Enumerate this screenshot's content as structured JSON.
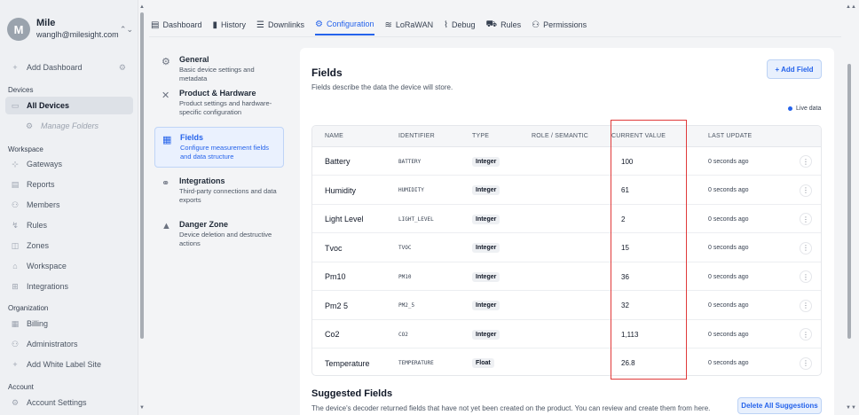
{
  "account": {
    "initial": "M",
    "name": "Mile",
    "email": "wanglh@milesight.com"
  },
  "sidebar": {
    "add_dashboard": "Add Dashboard",
    "devices_section": "Devices",
    "all_devices": "All Devices",
    "manage_folders": "Manage Folders",
    "workspace_section": "Workspace",
    "gateways": "Gateways",
    "reports": "Reports",
    "members": "Members",
    "rules": "Rules",
    "zones": "Zones",
    "workspace": "Workspace",
    "integrations": "Integrations",
    "organization_section": "Organization",
    "billing": "Billing",
    "administrators": "Administrators",
    "add_white_label": "Add White Label Site",
    "account_section": "Account",
    "account_settings": "Account Settings"
  },
  "tabs": [
    "Dashboard",
    "History",
    "Downlinks",
    "Configuration",
    "LoRaWAN",
    "Debug",
    "Rules",
    "Permissions"
  ],
  "settings_nav": [
    {
      "title": "General",
      "desc": "Basic device settings and metadata"
    },
    {
      "title": "Product & Hardware",
      "desc": "Product settings and hardware-specific configuration"
    },
    {
      "title": "Fields",
      "desc": "Configure measurement fields and data structure"
    },
    {
      "title": "Integrations",
      "desc": "Third-party connections and data exports"
    },
    {
      "title": "Danger Zone",
      "desc": "Device deletion and destructive actions"
    }
  ],
  "fields": {
    "title": "Fields",
    "description": "Fields describe the data the device will store.",
    "add_button": "+ Add Field",
    "live_data": "Live data",
    "columns": [
      "NAME",
      "IDENTIFIER",
      "TYPE",
      "ROLE / SEMANTIC",
      "CURRENT VALUE",
      "LAST UPDATE"
    ],
    "rows": [
      {
        "name": "Battery",
        "identifier": "BATTERY",
        "type": "Integer",
        "value": "100",
        "updated": "0 seconds ago"
      },
      {
        "name": "Humidity",
        "identifier": "HUMIDITY",
        "type": "Integer",
        "value": "61",
        "updated": "0 seconds ago"
      },
      {
        "name": "Light Level",
        "identifier": "LIGHT_LEVEL",
        "type": "Integer",
        "value": "2",
        "updated": "0 seconds ago"
      },
      {
        "name": "Tvoc",
        "identifier": "TVOC",
        "type": "Integer",
        "value": "15",
        "updated": "0 seconds ago"
      },
      {
        "name": "Pm10",
        "identifier": "PM10",
        "type": "Integer",
        "value": "36",
        "updated": "0 seconds ago"
      },
      {
        "name": "Pm2 5",
        "identifier": "PM2_5",
        "type": "Integer",
        "value": "32",
        "updated": "0 seconds ago"
      },
      {
        "name": "Co2",
        "identifier": "CO2",
        "type": "Integer",
        "value": "1,113",
        "updated": "0 seconds ago"
      },
      {
        "name": "Temperature",
        "identifier": "TEMPERATURE",
        "type": "Float",
        "value": "26.8",
        "updated": "0 seconds ago"
      }
    ]
  },
  "suggested": {
    "title": "Suggested Fields",
    "description": "The device's decoder returned fields that have not yet been created on the product. You can review and create them from here.",
    "delete_button": "Delete All Suggestions"
  },
  "colors": {
    "accent": "#2563eb",
    "highlight": "#e03a3a"
  }
}
